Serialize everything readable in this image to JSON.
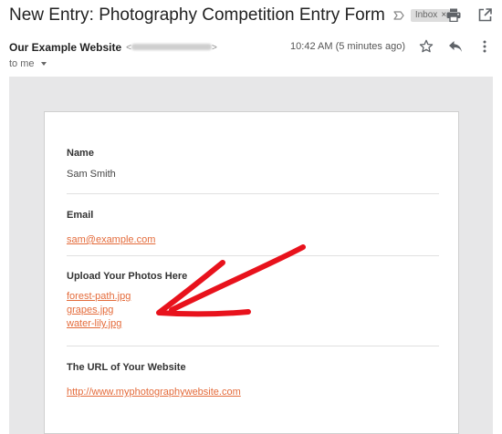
{
  "email": {
    "subject": "New Entry: Photography Competition Entry Form",
    "label": "Inbox",
    "label_remove": "×",
    "sender_name": "Our Example Website",
    "sender_email_open": "<",
    "sender_email_close": ">",
    "recipient": "to me",
    "timestamp": "10:42 AM (5 minutes ago)"
  },
  "form": {
    "name_label": "Name",
    "name_value": "Sam Smith",
    "email_label": "Email",
    "email_value": "sam@example.com",
    "upload_label": "Upload Your Photos Here",
    "files": [
      "forest-path.jpg",
      "grapes.jpg",
      "water-lily.jpg"
    ],
    "url_label": "The URL of Your Website",
    "url_value": "http://www.myphotographywebsite.com"
  },
  "colors": {
    "link": "#e46b3b",
    "arrow": "#e8121c",
    "background": "#e7e7e8"
  },
  "icons": [
    "importance-marker-icon",
    "print-icon",
    "open-in-new-window-icon",
    "star-icon",
    "reply-icon",
    "more-options-icon",
    "annotation-arrow-icon"
  ]
}
